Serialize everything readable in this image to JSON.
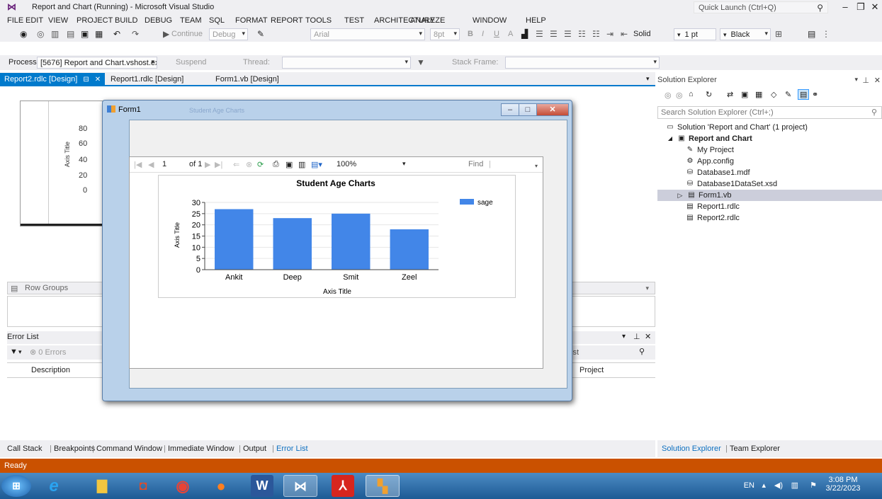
{
  "window": {
    "title": "Report and Chart (Running) - Microsoft Visual Studio",
    "quick_launch_placeholder": "Quick Launch (Ctrl+Q)"
  },
  "menu": [
    "FILE",
    "EDIT",
    "VIEW",
    "PROJECT",
    "BUILD",
    "DEBUG",
    "TEAM",
    "SQL",
    "FORMAT",
    "REPORT",
    "TOOLS",
    "TEST",
    "ARCHITECTURE",
    "ANALYZE",
    "WINDOW",
    "HELP"
  ],
  "toolbar1": {
    "continue_label": "Continue",
    "config": "Debug",
    "font": "Arial",
    "font_size": "8pt",
    "line_style": "Solid",
    "line_width": "1 pt",
    "line_color": "Black"
  },
  "toolbar2": {
    "process_label": "Process:",
    "process_value": "[5676] Report and Chart.vshost.exe",
    "suspend_label": "Suspend",
    "thread_label": "Thread:",
    "stack_label": "Stack Frame:"
  },
  "doc_tabs": [
    "Report2.rdlc [Design]",
    "Report1.rdlc [Design]",
    "Form1.vb [Design]"
  ],
  "background_chart": {
    "ticks": [
      "80",
      "60",
      "40",
      "20",
      "0"
    ],
    "ylabel": "Axis Title"
  },
  "row_groups_label": "Row Groups",
  "error_list": {
    "title": "Error List",
    "errors": "0 Errors",
    "col_description": "Description",
    "col_project": "Project",
    "search_suffix": "List"
  },
  "bottom_tabs": [
    "Call Stack",
    "Breakpoints",
    "Command Window",
    "Immediate Window",
    "Output",
    "Error List"
  ],
  "solution_explorer": {
    "title": "Solution Explorer",
    "search_placeholder": "Search Solution Explorer (Ctrl+;)",
    "tree": [
      {
        "label": "Solution 'Report and Chart' (1 project)",
        "indent": 0,
        "icon": "solution-icon"
      },
      {
        "label": "Report and Chart",
        "indent": 1,
        "icon": "vb-project-icon",
        "bold": true
      },
      {
        "label": "My Project",
        "indent": 2,
        "icon": "wrench-icon"
      },
      {
        "label": "App.config",
        "indent": 2,
        "icon": "config-icon"
      },
      {
        "label": "Database1.mdf",
        "indent": 2,
        "icon": "database-icon"
      },
      {
        "label": "Database1DataSet.xsd",
        "indent": 2,
        "icon": "dataset-icon"
      },
      {
        "label": "Form1.vb",
        "indent": 2,
        "icon": "form-icon",
        "selected": true
      },
      {
        "label": "Report1.rdlc",
        "indent": 2,
        "icon": "report-icon"
      },
      {
        "label": "Report2.rdlc",
        "indent": 2,
        "icon": "report-icon"
      }
    ],
    "tabs": [
      "Solution Explorer",
      "Team Explorer"
    ]
  },
  "status": "Ready",
  "form1": {
    "title": "Form1",
    "ghost_title": "Student Age Charts"
  },
  "report_viewer": {
    "page": "1",
    "of_pages": "of 1",
    "zoom": "100%",
    "find_label": "Find"
  },
  "chart_data": {
    "type": "bar",
    "title": "Student Age Charts",
    "categories": [
      "Ankit",
      "Deep",
      "Smit",
      "Zeel"
    ],
    "series": [
      {
        "name": "sage",
        "values": [
          27,
          23,
          25,
          18
        ]
      }
    ],
    "xlabel": "Axis Title",
    "ylabel": "Axis Title",
    "ylim": [
      0,
      30
    ],
    "yticks": [
      0,
      5,
      10,
      15,
      20,
      25,
      30
    ],
    "legend": "top-right",
    "bar_color": "#4286e8"
  },
  "tray": {
    "lang": "EN",
    "time": "3:08 PM",
    "date": "3/22/2023"
  }
}
